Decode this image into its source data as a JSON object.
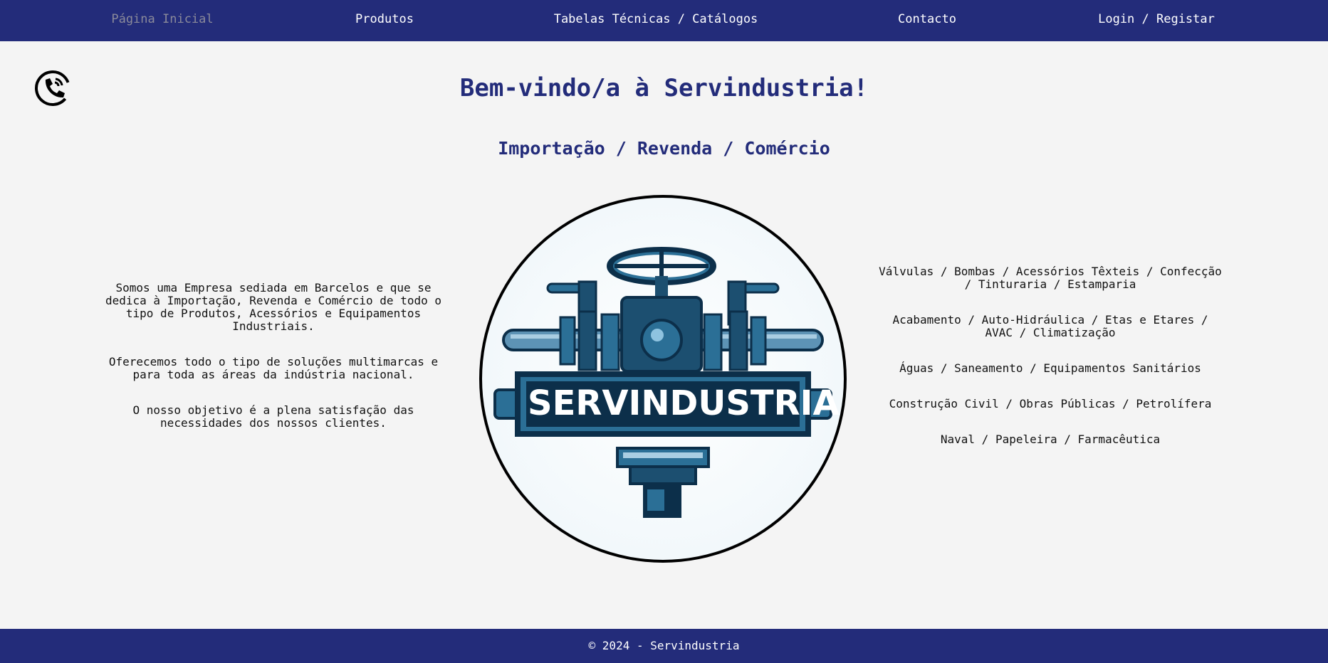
{
  "nav": {
    "items": [
      {
        "label": "Página Inicial",
        "active": true
      },
      {
        "label": "Produtos"
      },
      {
        "label": "Tabelas Técnicas / Catálogos"
      },
      {
        "label": "Contacto"
      },
      {
        "label": "Login / Registar"
      }
    ]
  },
  "icons": {
    "phone": "phone-icon"
  },
  "header": {
    "title": "Bem-vindo/a à Servindustria!",
    "subtitle": "Importação / Revenda / Comércio"
  },
  "left": {
    "p1": "Somos uma Empresa sediada em Barcelos e que se dedica à Importação, Revenda e Comércio de todo o tipo de Produtos, Acessórios e Equipamentos Industriais.",
    "p2": "Oferecemos todo o tipo de soluções multimarcas e para toda as áreas da indústria nacional.",
    "p3": "O nosso objetivo é a plena satisfação das necessidades dos nossos clientes."
  },
  "logo": {
    "word": "SERVINDUSTRIA"
  },
  "right": {
    "sectors": [
      "Válvulas / Bombas / Acessórios Têxteis / Confecção / Tinturaria / Estamparia",
      "Acabamento / Auto-Hidráulica / Etas e Etares / AVAC / Climatização",
      "Águas / Saneamento / Equipamentos Sanitários",
      "Construção Civil / Obras Públicas / Petrolífera",
      "Naval / Papeleira / Farmacêutica"
    ]
  },
  "footer": {
    "text": "© 2024 - Servindustria"
  },
  "colors": {
    "brand": "#232c7a",
    "background": "#f4f4f4",
    "logo_dark": "#0c2f4a",
    "logo_mid": "#2b6f96"
  }
}
